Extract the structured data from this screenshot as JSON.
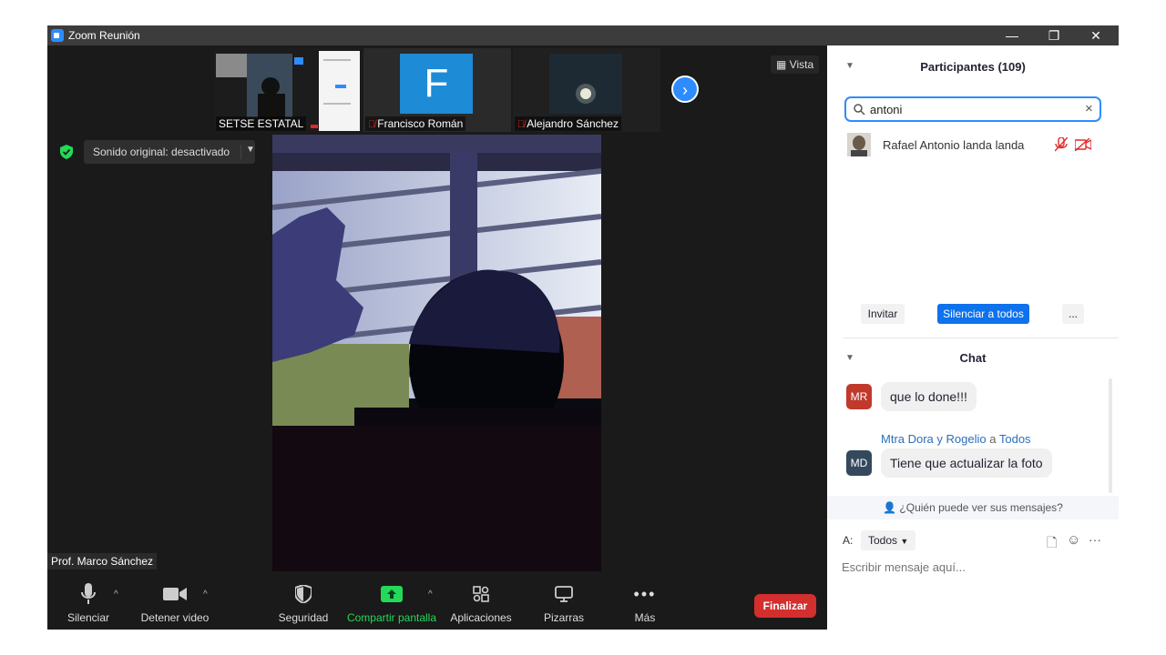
{
  "window": {
    "title": "Zoom Reunión",
    "minimize": "—",
    "maximize": "❐",
    "close": "✕"
  },
  "meeting": {
    "vista_label": "Vista",
    "audio_dropdown": "Sonido original: desactivado",
    "thumbnails": [
      {
        "name": "SETSE ESTATAL",
        "muted": false
      },
      {
        "name": "Francisco Román",
        "muted": true,
        "initial": "F"
      },
      {
        "name": "Alejandro Sánchez",
        "muted": true
      }
    ],
    "active_speaker": "Prof. Marco Sánchez"
  },
  "toolbar": {
    "mute": "Silenciar",
    "video": "Detener video",
    "security": "Seguridad",
    "share": "Compartir pantalla",
    "apps": "Aplicaciones",
    "whiteboards": "Pizarras",
    "more": "Más",
    "end": "Finalizar"
  },
  "participants": {
    "title": "Participantes (109)",
    "search_value": "antoni",
    "list": [
      {
        "name": "Rafael Antonio landa landa",
        "audio_muted": true,
        "video_off": true
      }
    ],
    "invite": "Invitar",
    "mute_all": "Silenciar a todos",
    "more": "..."
  },
  "chat": {
    "title": "Chat",
    "messages": [
      {
        "avatar": "MR",
        "avatar_color": "#c0392b",
        "text": "que lo done!!!"
      },
      {
        "avatar": "MD",
        "avatar_color": "#34495e",
        "sender": "Mtra Dora y Rogelio",
        "to_word": "a",
        "recipient": "Todos",
        "text": "Tiene que actualizar la foto"
      }
    ],
    "visibility_note": "¿Quién puede ver sus mensajes?",
    "to_label": "A:",
    "to_value": "Todos",
    "placeholder": "Escribir mensaje aquí..."
  },
  "colors": {
    "accent": "#2d8cff",
    "end_red": "#d32f2f",
    "share_green": "#23d959",
    "muted_red": "#e02828"
  }
}
